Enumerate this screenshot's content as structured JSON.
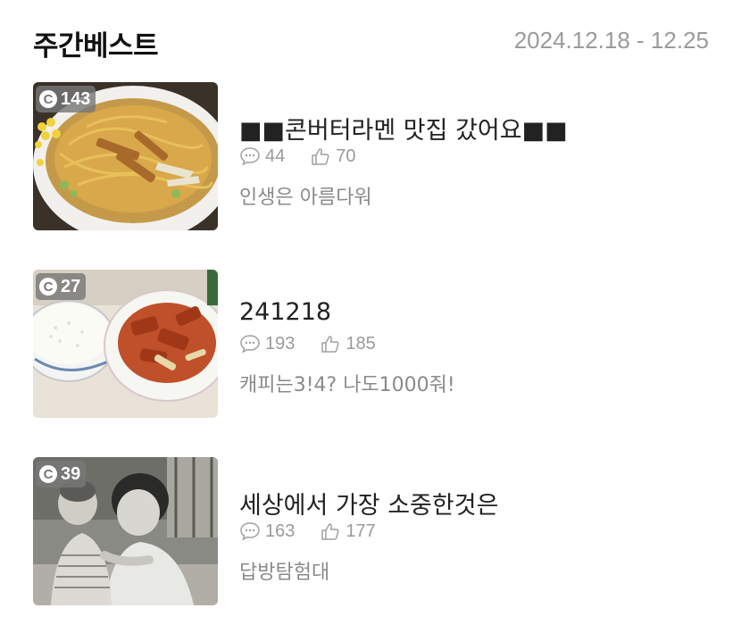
{
  "header": {
    "title": "주간베스트",
    "date_range": "2024.12.18 - 12.25"
  },
  "posts": [
    {
      "badge_count": "143",
      "title": "■■콘버터라멘 맛집 갔어요■■",
      "comments": "44",
      "likes": "70",
      "subtitle": "인생은 아름다워"
    },
    {
      "badge_count": "27",
      "title": "241218",
      "comments": "193",
      "likes": "185",
      "subtitle": "캐피는3!4? 나도1000줘!"
    },
    {
      "badge_count": "39",
      "title": "세상에서 가장 소중한것은",
      "comments": "163",
      "likes": "177",
      "subtitle": "답방탐험대"
    }
  ],
  "icons": {
    "badge": "comment-c-icon",
    "comments": "speech-bubble-icon",
    "likes": "thumbs-up-icon"
  },
  "colors": {
    "title": "#111111",
    "muted": "#9a9a9a",
    "badge_bg": "#787878"
  }
}
